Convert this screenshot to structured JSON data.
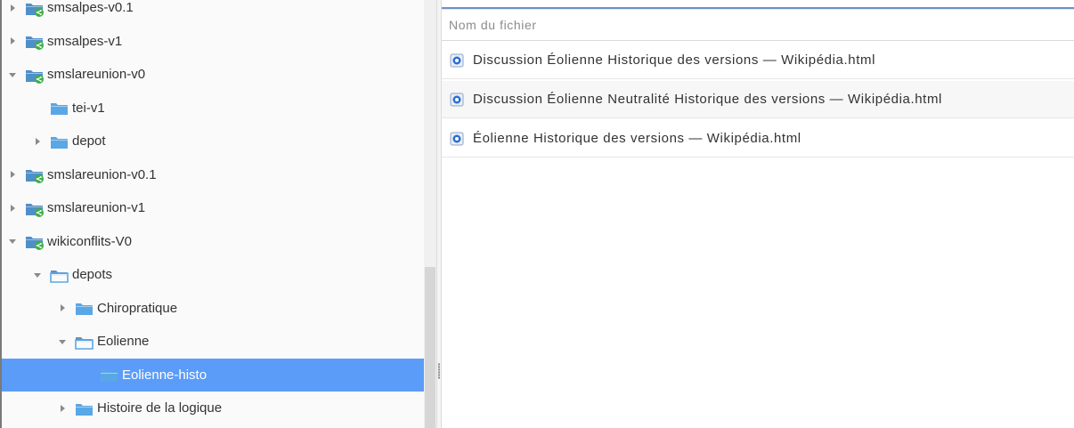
{
  "tree": {
    "items": [
      {
        "label": "smsalpes-v0.1",
        "toggle": "right",
        "icon": "shared-folder-icon",
        "depth": 0,
        "selected": false
      },
      {
        "label": "smsalpes-v1",
        "toggle": "right",
        "icon": "shared-folder-icon",
        "depth": 0,
        "selected": false
      },
      {
        "label": "smslareunion-v0",
        "toggle": "down",
        "icon": "shared-folder-icon",
        "depth": 0,
        "selected": false
      },
      {
        "label": "tei-v1",
        "toggle": "none",
        "icon": "folder-icon",
        "depth": 1,
        "selected": false
      },
      {
        "label": "depot",
        "toggle": "right",
        "icon": "folder-icon",
        "depth": 1,
        "selected": false
      },
      {
        "label": "smslareunion-v0.1",
        "toggle": "right",
        "icon": "shared-folder-icon",
        "depth": 0,
        "selected": false
      },
      {
        "label": "smslareunion-v1",
        "toggle": "right",
        "icon": "shared-folder-icon",
        "depth": 0,
        "selected": false
      },
      {
        "label": "wikiconflits-V0",
        "toggle": "down",
        "icon": "shared-folder-icon",
        "depth": 0,
        "selected": false
      },
      {
        "label": "depots",
        "toggle": "down",
        "icon": "open-folder-icon",
        "depth": 1,
        "selected": false
      },
      {
        "label": "Chiropratique",
        "toggle": "right",
        "icon": "folder-icon",
        "depth": 2,
        "selected": false
      },
      {
        "label": "Eolienne",
        "toggle": "down",
        "icon": "open-folder-icon",
        "depth": 2,
        "selected": false
      },
      {
        "label": "Eolienne-histo",
        "toggle": "none",
        "icon": "folder-icon",
        "depth": 3,
        "selected": true
      },
      {
        "label": "Histoire de la logique",
        "toggle": "right",
        "icon": "folder-icon",
        "depth": 2,
        "selected": false
      }
    ]
  },
  "file_list": {
    "header": "Nom du fichier",
    "files": [
      {
        "name": "Discussion Éolienne Historique des versions — Wikipédia.html",
        "icon": "html-file-icon"
      },
      {
        "name": "Discussion Éolienne Neutralité Historique des versions — Wikipédia.html",
        "icon": "html-file-icon"
      },
      {
        "name": "Éolienne Historique des versions — Wikipédia.html",
        "icon": "html-file-icon"
      }
    ]
  },
  "colors": {
    "selection": "#5b9cf8",
    "folder": "#5aa7e6",
    "shared_badge": "#3fae49",
    "header_accent": "#6a93c9"
  }
}
